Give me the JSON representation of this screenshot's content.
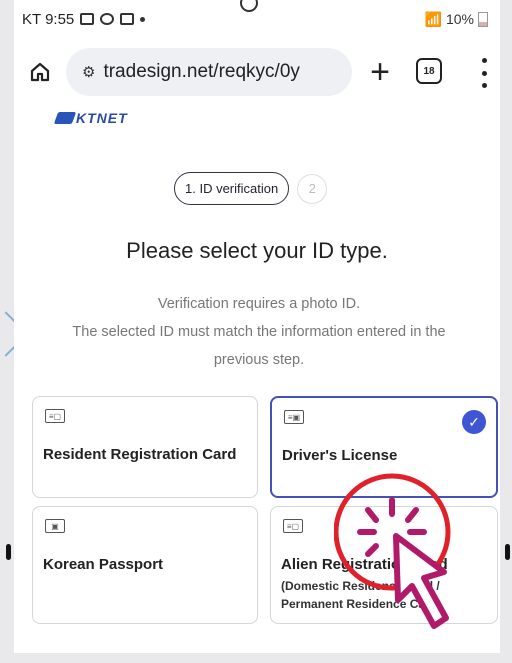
{
  "status_bar": {
    "time": "KT 9:55",
    "battery": "10%"
  },
  "browser": {
    "url": "tradesign.net/reqkyc/0y",
    "tab_count": "18"
  },
  "logo": {
    "text": "KTNET"
  },
  "steps": {
    "active": "1. ID verification",
    "next": "2"
  },
  "title": "Please select your ID type.",
  "description": [
    "Verification requires a photo ID.",
    "The selected ID must match the information entered in the",
    "previous step."
  ],
  "id_options": [
    {
      "label": "Resident Registration Card",
      "selected": false
    },
    {
      "label": "Driver's License",
      "selected": true
    },
    {
      "label": "Korean Passport",
      "selected": false
    },
    {
      "label": "Alien Registration Card",
      "sub": "(Domestic Residence Card / Permanent Residence Card)",
      "selected": false
    }
  ],
  "colors": {
    "accent": "#3e56d4",
    "selected_border": "#4452b8",
    "highlight": "#e0202a",
    "cursor": "#b01a68"
  }
}
